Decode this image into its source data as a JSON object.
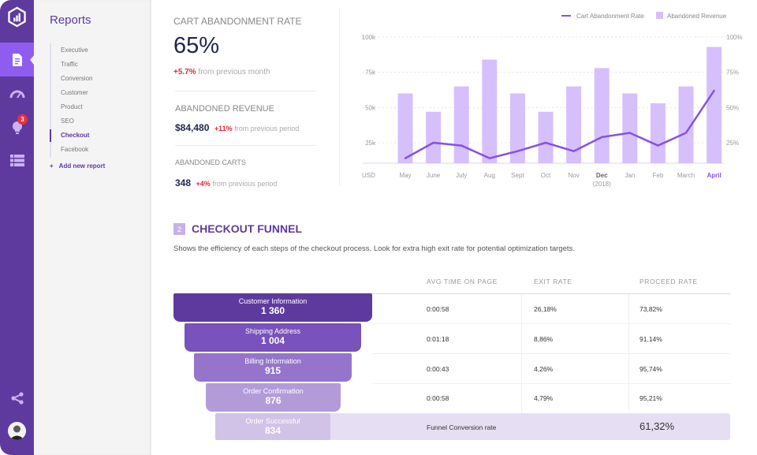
{
  "rail": {
    "logo": "hexagon-chart-logo",
    "items": [
      {
        "icon": "document-icon",
        "active": true
      },
      {
        "icon": "speedometer-icon",
        "active": false
      },
      {
        "icon": "lightbulb-icon",
        "active": false,
        "badge": "3"
      },
      {
        "icon": "list-icon",
        "active": false
      }
    ],
    "bottom": [
      {
        "icon": "share-icon"
      },
      {
        "icon": "avatar"
      }
    ]
  },
  "sidebar": {
    "title": "Reports",
    "items": [
      {
        "label": "Executive"
      },
      {
        "label": "Traffic"
      },
      {
        "label": "Conversion"
      },
      {
        "label": "Customer"
      },
      {
        "label": "Product"
      },
      {
        "label": "SEO"
      },
      {
        "label": "Checkout",
        "active": true
      },
      {
        "label": "Facebook"
      }
    ],
    "add_label": "Add new report",
    "add_icon": "+"
  },
  "kpis": {
    "rate": {
      "label": "CART ABANDONMENT RATE",
      "value": "65%",
      "delta": "+5.7%",
      "delta_text": "from previous month"
    },
    "revenue": {
      "label": "ABANDONED REVENUE",
      "value": "$84,480",
      "delta": "+11%",
      "delta_text": "from previous period"
    },
    "carts": {
      "label": "ABANDONED CARTS",
      "value": "348",
      "delta": "+4%",
      "delta_text": "from previous period"
    }
  },
  "chart_data": {
    "type": "bar",
    "categories": [
      "May",
      "June",
      "July",
      "Aug",
      "Sept",
      "Oct",
      "Nov",
      "Dec",
      "Jan",
      "Feb",
      "March",
      "April"
    ],
    "category_sublabels": {
      "Dec": "(2018)"
    },
    "highlight_category": "April",
    "bold_category": "Dec",
    "series": [
      {
        "name": "Abandoned Revenue",
        "type": "bar",
        "axis": "left",
        "color": "#d6c0fb",
        "values": [
          60000,
          47000,
          65000,
          84000,
          60000,
          47000,
          65000,
          78000,
          60000,
          53000,
          65000,
          93000
        ]
      },
      {
        "name": "Cart Abandonment Rate",
        "type": "line",
        "axis": "right",
        "color": "#8651e6",
        "values": [
          14,
          25,
          23,
          14,
          19,
          25,
          19,
          29,
          32,
          23,
          32,
          62
        ]
      }
    ],
    "left_axis": {
      "label": "USD",
      "ticks": [
        "25k",
        "50k",
        "75k",
        "100k"
      ],
      "tick_values": [
        25000,
        50000,
        75000,
        100000
      ]
    },
    "right_axis": {
      "ticks": [
        "25%",
        "50%",
        "75%",
        "100%"
      ],
      "tick_values": [
        25,
        50,
        75,
        100
      ]
    },
    "legend": [
      {
        "label": "Cart Abandonment Rate",
        "kind": "line"
      },
      {
        "label": "Abandoned Revenue",
        "kind": "square"
      }
    ],
    "legend_position": "top-right",
    "grid": true
  },
  "funnel": {
    "section_number": "2",
    "title": "CHECKOUT FUNNEL",
    "description": "Shows the efficiency of each steps of the checkout process. Look for extra high exit rate for potential optimization targets.",
    "columns": [
      "AVG TIME ON PAGE",
      "EXIT RATE",
      "PROCEED RATE"
    ],
    "steps": [
      {
        "name": "Customer Information",
        "count": "1 360",
        "avg_time": "0:00:58",
        "exit_rate": "26,18%",
        "proceed_rate": "73,82%",
        "color": "#5f3a9e"
      },
      {
        "name": "Shipping Address",
        "count": "1 004",
        "avg_time": "0:01:18",
        "exit_rate": "8,86%",
        "proceed_rate": "91,14%",
        "color": "#7a52bb"
      },
      {
        "name": "Billing Information",
        "count": "915",
        "avg_time": "0:00:43",
        "exit_rate": "4,26%",
        "proceed_rate": "95,74%",
        "color": "#9574cb"
      },
      {
        "name": "Order Confirmation",
        "count": "876",
        "avg_time": "0:00:58",
        "exit_rate": "4,79%",
        "proceed_rate": "95,21%",
        "color": "#b39bd9"
      },
      {
        "name": "Order Successful",
        "count": "834",
        "color": "#d1c2e8"
      }
    ],
    "total_label": "Funnel Conversion rate",
    "total_value": "61,32%"
  }
}
